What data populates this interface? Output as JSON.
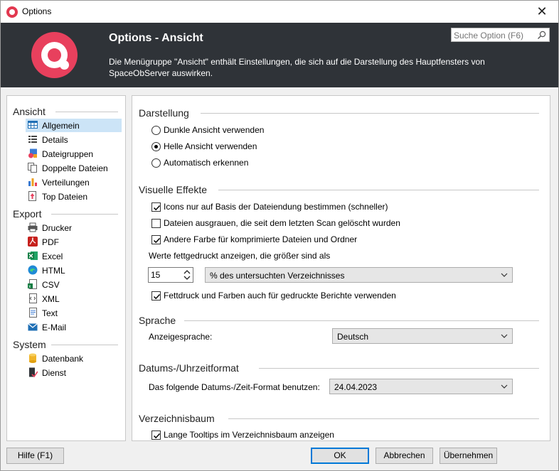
{
  "window": {
    "title": "Options",
    "close_glyph": "✕"
  },
  "header": {
    "title": "Options - Ansicht",
    "description": "Die Menügruppe \"Ansicht\" enthält Einstellungen, die sich auf die Darstellung des Hauptfensters von SpaceObServer auswirken.",
    "search_placeholder": "Suche Option (F6)"
  },
  "nav": {
    "groups": [
      {
        "label": "Ansicht"
      },
      {
        "label": "Export"
      },
      {
        "label": "System"
      }
    ],
    "items": [
      {
        "label": "Allgemein",
        "icon": "general-grid-icon"
      },
      {
        "label": "Details",
        "icon": "details-list-icon"
      },
      {
        "label": "Dateigruppen",
        "icon": "file-groups-icon"
      },
      {
        "label": "Doppelte Dateien",
        "icon": "duplicate-files-icon"
      },
      {
        "label": "Verteilungen",
        "icon": "distribution-chart-icon"
      },
      {
        "label": "Top Dateien",
        "icon": "top-files-icon"
      },
      {
        "label": "Drucker",
        "icon": "printer-icon"
      },
      {
        "label": "PDF",
        "icon": "pdf-icon"
      },
      {
        "label": "Excel",
        "icon": "excel-icon"
      },
      {
        "label": "HTML",
        "icon": "html-icon"
      },
      {
        "label": "CSV",
        "icon": "csv-icon"
      },
      {
        "label": "XML",
        "icon": "xml-icon"
      },
      {
        "label": "Text",
        "icon": "text-icon"
      },
      {
        "label": "E-Mail",
        "icon": "email-icon"
      },
      {
        "label": "Datenbank",
        "icon": "database-icon"
      },
      {
        "label": "Dienst",
        "icon": "service-icon"
      }
    ],
    "selected": "Allgemein"
  },
  "content": {
    "darstellung": {
      "title": "Darstellung",
      "options": [
        "Dunkle Ansicht verwenden",
        "Helle Ansicht verwenden",
        "Automatisch erkennen"
      ],
      "selected": "Helle Ansicht verwenden"
    },
    "effekte": {
      "title": "Visuelle Effekte",
      "icons_cb": {
        "label": "Icons nur auf Basis der Dateiendung bestimmen (schneller)",
        "checked": true
      },
      "grey_cb": {
        "label": "Dateien ausgrauen, die seit dem letzten Scan gelöscht wurden",
        "checked": false
      },
      "color_cb": {
        "label": "Andere Farbe für komprimierte Dateien und Ordner",
        "checked": true
      },
      "bold_label": "Werte fettgedruckt anzeigen, die größer sind als",
      "bold_value": "15",
      "bold_unit": "% des untersuchten Verzeichnisses",
      "print_cb": {
        "label": "Fettdruck und Farben auch für gedruckte Berichte verwenden",
        "checked": true
      }
    },
    "sprache": {
      "title": "Sprache",
      "label": "Anzeigesprache:",
      "value": "Deutsch"
    },
    "datum": {
      "title": "Datums-/Uhrzeitformat",
      "label": "Das folgende Datums-/Zeit-Format benutzen:",
      "value": "24.04.2023"
    },
    "baum": {
      "title": "Verzeichnisbaum",
      "tooltip_cb": {
        "label": "Lange Tooltips im Verzeichnisbaum anzeigen",
        "checked": true
      }
    }
  },
  "footer": {
    "help": "Hilfe (F1)",
    "ok": "OK",
    "cancel": "Abbrechen",
    "apply": "Übernehmen"
  },
  "colors": {
    "brand": "#e8405d",
    "header_bg": "#2f3338",
    "selection": "#cce4f7",
    "focus": "#0078d7"
  }
}
